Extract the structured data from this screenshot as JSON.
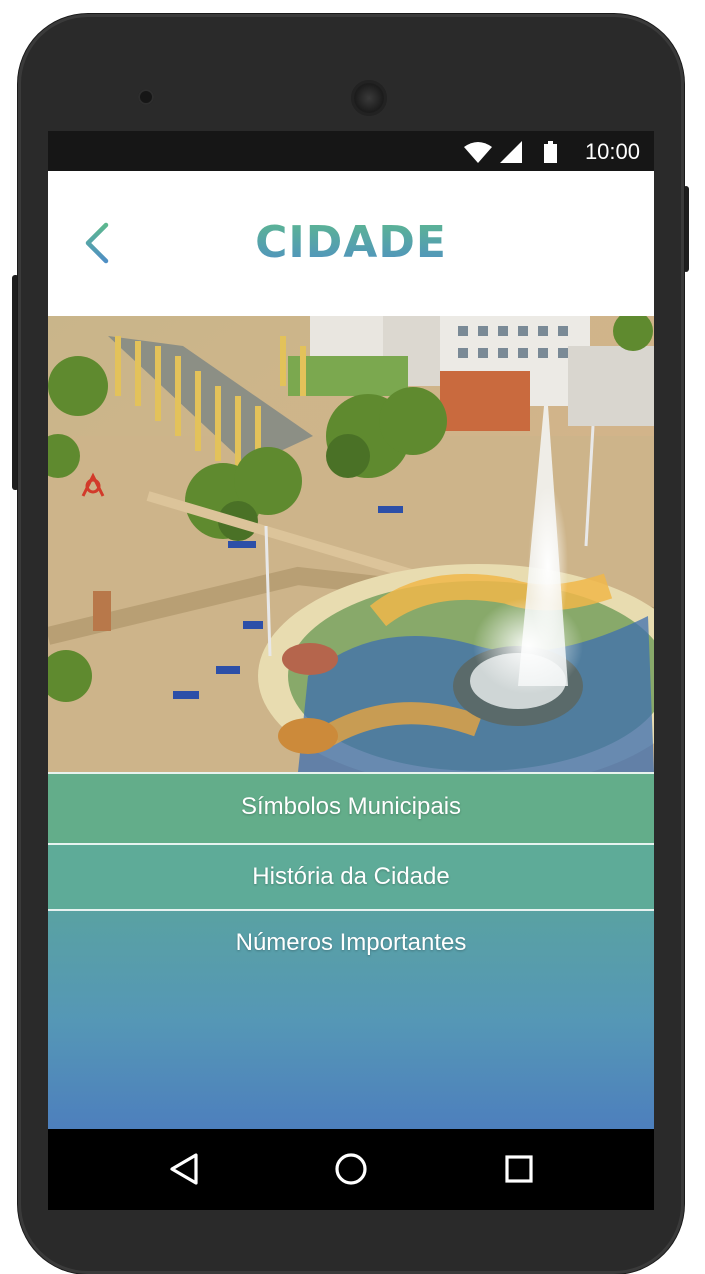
{
  "status_bar": {
    "time": "10:00",
    "icons": [
      "wifi-icon",
      "signal-icon",
      "battery-icon"
    ]
  },
  "app_bar": {
    "title": "CIDADE",
    "back_icon": "chevron-left-icon",
    "title_gradient": [
      "#5db88f",
      "#4f8fc4"
    ]
  },
  "hero_image": {
    "description_icon": "city-square-photo"
  },
  "menu": {
    "items": [
      {
        "label": "Símbolos Municipais"
      },
      {
        "label": "História da Cidade"
      },
      {
        "label": "Números Importantes"
      }
    ],
    "colors": [
      "#63ad8a",
      "#5597b6",
      "#4d7fbd"
    ]
  },
  "nav_bar": {
    "icons": [
      "back-triangle-icon",
      "home-circle-icon",
      "recent-apps-square-icon"
    ]
  }
}
